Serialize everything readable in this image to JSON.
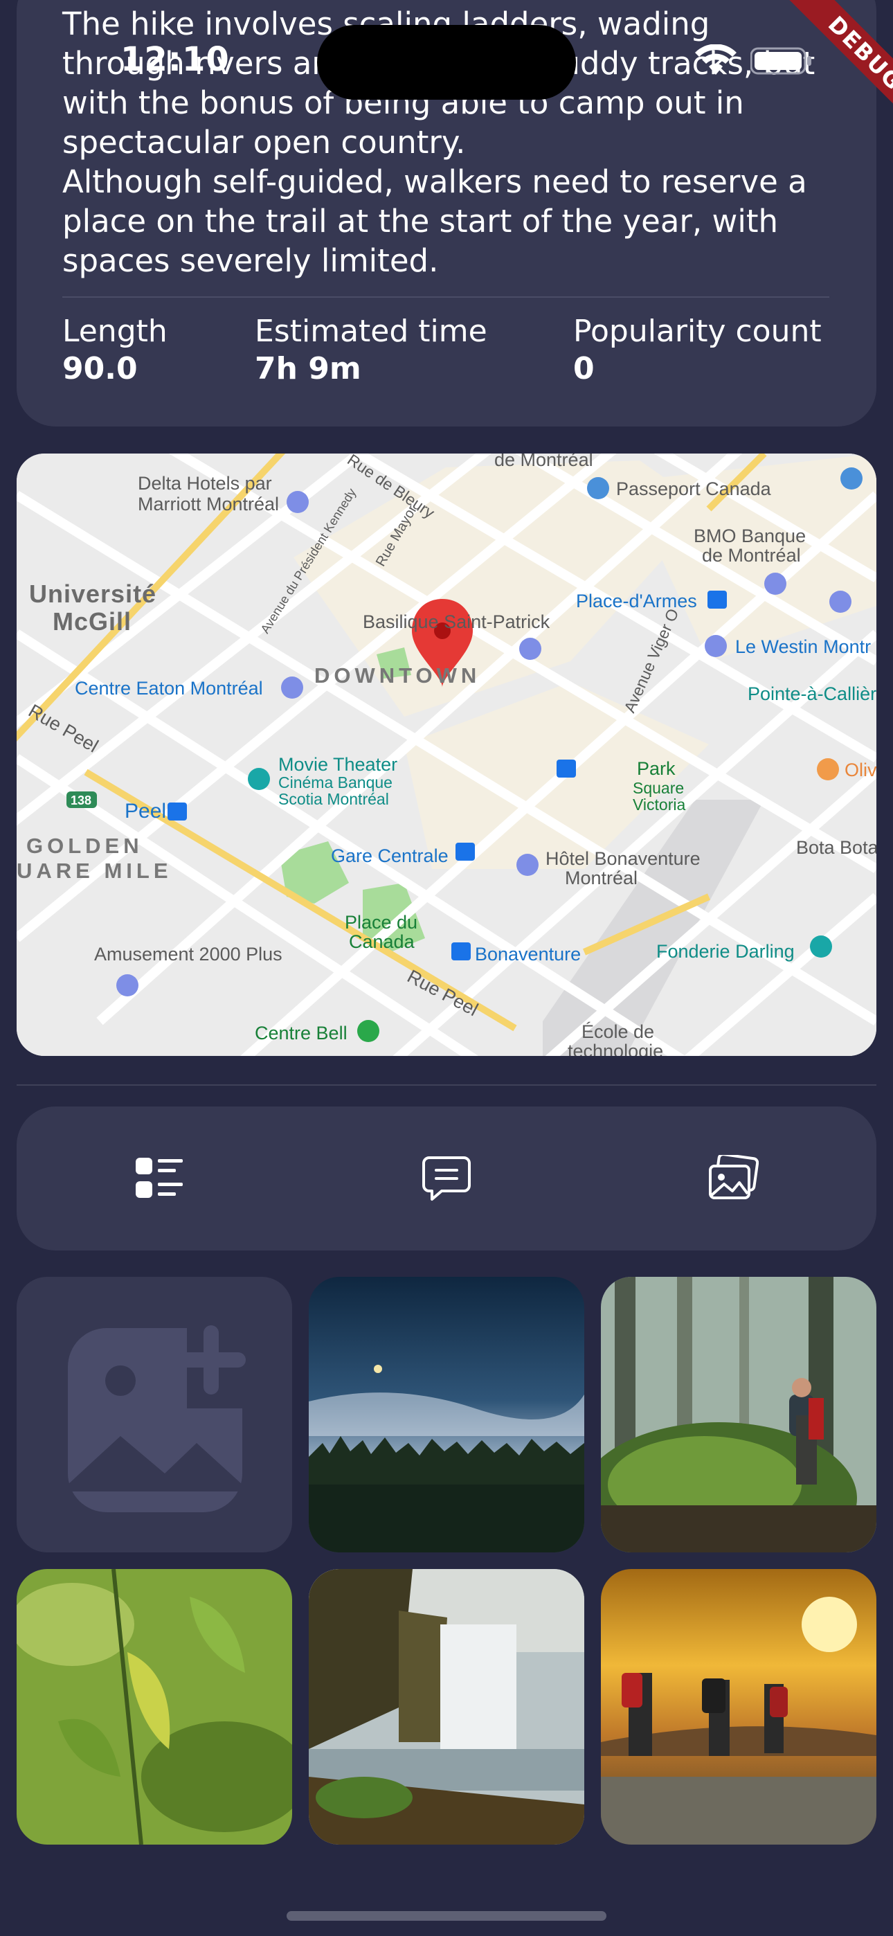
{
  "status_bar": {
    "time": "12:10"
  },
  "debug_banner": "DEBUG",
  "details": {
    "paragraphs": [
      "The hike involves scaling ladders, wading through rivers and traversing muddy tracks, but with the bonus of being able to camp out in spectacular open country.",
      "Although self-guided, walkers need to reserve a place on the trail at the start of the year, with spaces severely limited."
    ],
    "stats": [
      {
        "label": "Length",
        "value": "90.0"
      },
      {
        "label": "Estimated time",
        "value": "7h 9m"
      },
      {
        "label": "Popularity count",
        "value": "0"
      }
    ]
  },
  "map": {
    "labels": {
      "delta": "Delta Hotels par",
      "delta2": "Marriott Montréal",
      "passport": "Passeport Canada",
      "bmo": "BMO Banque",
      "bmo2": "de Montréal",
      "mcgill": "Université",
      "mcgill2": "McGill",
      "basilique": "Basilique Saint-Patrick",
      "place_armes": "Place-d'Armes",
      "westin": "Le Westin Montr",
      "eaton": "Centre Eaton Montréal",
      "downtown": "DOWNTOWN",
      "pointe": "Pointe-à-Callière",
      "movie": "Movie Theater",
      "movie2": "Cinéma Banque",
      "movie3": "Scotia Montréal",
      "park": "Park",
      "square": "Square",
      "victoria": "Victoria",
      "olive": "Oliv",
      "peel": "Peel",
      "golden": "GOLDEN",
      "square_mile": "UARE MILE",
      "gare": "Gare Centrale",
      "hotel": "Hôtel Bonaventure",
      "hotel2": "Montréal",
      "bota": "Bota Bota",
      "place_canada": "Place du",
      "place_canada2": "Canada",
      "amusement": "Amusement 2000 Plus",
      "bonaventure": "Bonaventure",
      "fonderie": "Fonderie Darling",
      "bell": "Centre Bell",
      "ecole": "École de",
      "ecole2": "technologie",
      "rue_peel": "Rue Peel",
      "rue_peel2": "Rue Peel",
      "rue_bleury": "Rue de Bleury",
      "rue_mayor": "Rue Mayor",
      "av_kennedy": "Avenue du Président Kennedy",
      "av_viger": "Avenue Viger O",
      "hwy": "138",
      "de_montreal": "de Montréal"
    }
  },
  "tabs": [
    {
      "icon": "details-list-icon"
    },
    {
      "icon": "comments-icon"
    },
    {
      "icon": "gallery-icon"
    }
  ],
  "gallery": {
    "add_icon": "add-photo-icon",
    "photos": [
      "night-forest-moon",
      "hiker-mossy-forest",
      "green-leaves",
      "waterfall-cliff",
      "hikers-sunset"
    ]
  },
  "colors": {
    "background": "#262842",
    "card": "#363852",
    "debug": "#9a1b22"
  }
}
